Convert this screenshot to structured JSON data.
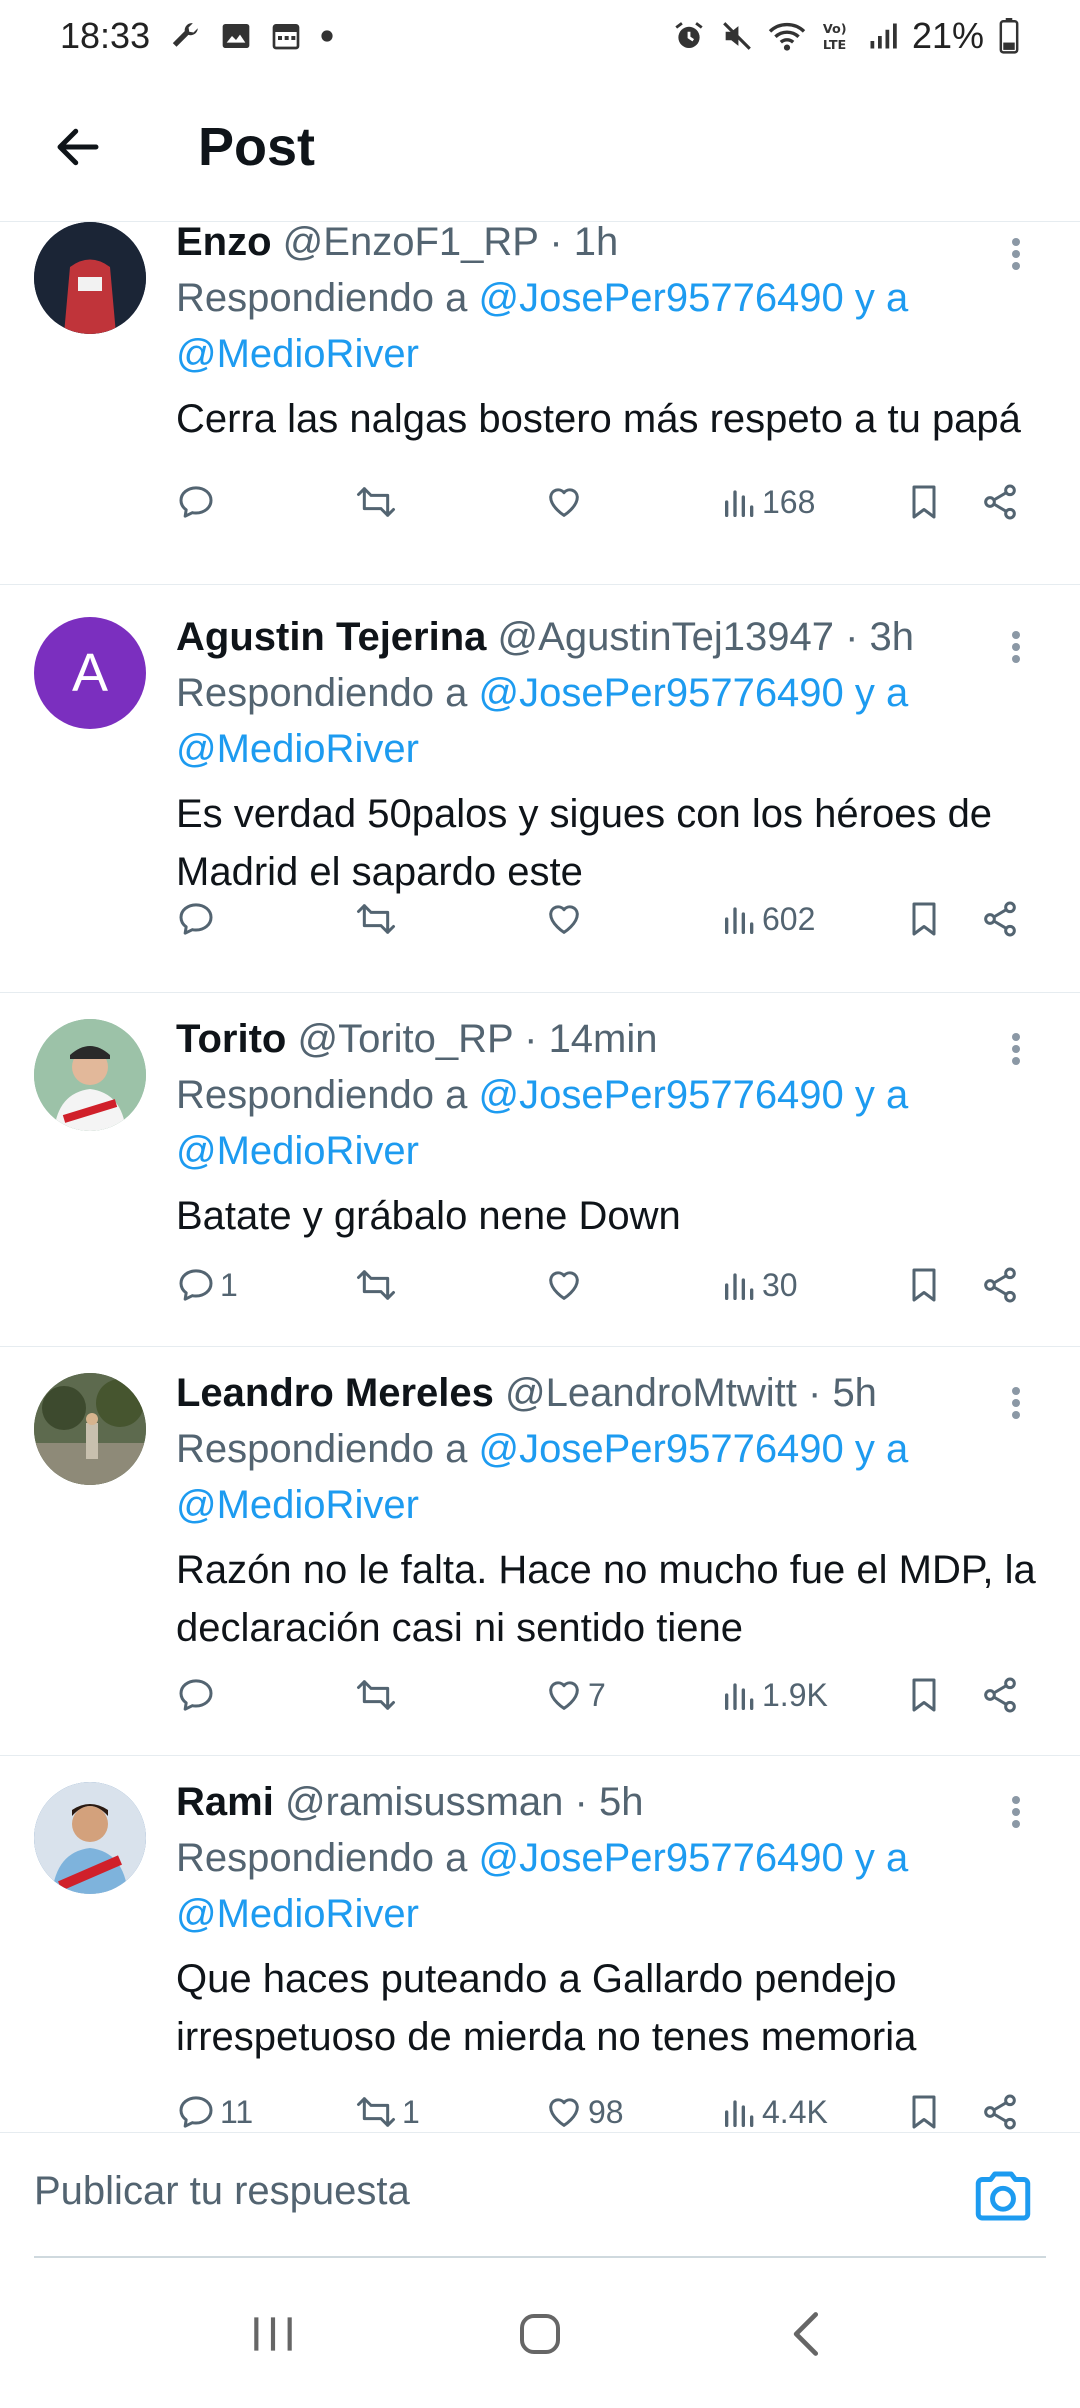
{
  "status_bar": {
    "time": "18:33",
    "battery": "21%",
    "left_icons": [
      "wrench-icon",
      "image-icon",
      "calendar-icon",
      "dot-icon"
    ],
    "right_icons": [
      "alarm-icon",
      "mute-icon",
      "wifi-icon",
      "volte-icon",
      "signal-icon",
      "battery-icon"
    ]
  },
  "header": {
    "title": "Post"
  },
  "replies": [
    {
      "name": "Enzo",
      "handle": "@EnzoF1_RP",
      "time": "1h",
      "reply_prefix": "Respondiendo a",
      "mention1": "@JosePer95776490",
      "joiner": "y a",
      "mention2": "@MedioRiver",
      "text": "Cerra las nalgas bostero más respeto a tu papá",
      "counts": {
        "replies": "",
        "reposts": "",
        "likes": "",
        "views": "168"
      },
      "avatar_color": "#1a2a4a"
    },
    {
      "name": "Agustin Tejerina",
      "handle": "@AgustinTej13947",
      "time": "3h",
      "reply_prefix": "Respondiendo a",
      "mention1": "@JosePer95776490",
      "joiner": "y a",
      "mention2": "@MedioRiver",
      "text": "Es verdad 50palos y sigues con los héroes de Madrid el sapardo este",
      "counts": {
        "replies": "",
        "reposts": "",
        "likes": "",
        "views": "602"
      },
      "avatar_letter": "A",
      "avatar_color": "#7b2fbf"
    },
    {
      "name": "Torito",
      "handle": "@Torito_RP",
      "time": "14min",
      "reply_prefix": "Respondiendo a",
      "mention1": "@JosePer95776490",
      "joiner": "y a",
      "mention2": "@MedioRiver",
      "text": "Batate y grábalo nene Down",
      "counts": {
        "replies": "1",
        "reposts": "",
        "likes": "",
        "views": "30"
      },
      "avatar_color": "#8fb3a0"
    },
    {
      "name": "Leandro Mereles",
      "handle": "@LeandroMtwitt",
      "time": "5h",
      "reply_prefix": "Respondiendo a",
      "mention1": "@JosePer95776490",
      "joiner": "y a",
      "mention2": "@MedioRiver",
      "text": "Razón no le falta. Hace no mucho fue el MDP, la declaración casi ni sentido tiene",
      "counts": {
        "replies": "",
        "reposts": "",
        "likes": "7",
        "views": "1.9K"
      },
      "avatar_color": "#4a5a3a"
    },
    {
      "name": "Rami",
      "handle": "@ramisussman",
      "time": "5h",
      "reply_prefix": "Respondiendo a",
      "mention1": "@JosePer95776490",
      "joiner": "y a",
      "mention2": "@MedioRiver",
      "text": "Que haces puteando a Gallardo pendejo irrespetuoso de mierda no tenes memoria",
      "counts": {
        "replies": "11",
        "reposts": "1",
        "likes": "98",
        "views": "4.4K"
      },
      "avatar_color": "#3a6fa8"
    }
  ],
  "composer": {
    "placeholder": "Publicar tu respuesta"
  },
  "colors": {
    "link": "#1d9bf0",
    "secondary": "#536471",
    "text": "#0f1419"
  }
}
